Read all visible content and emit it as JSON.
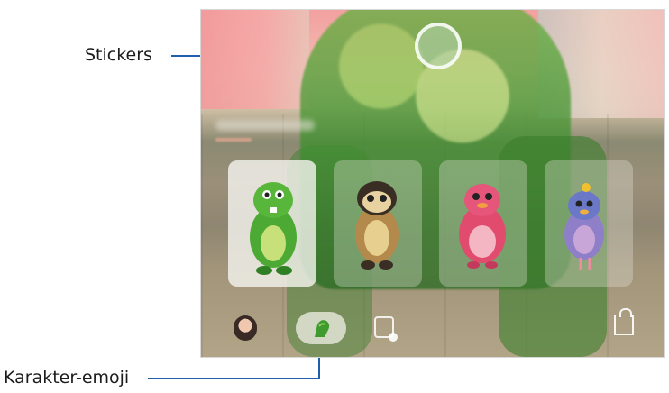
{
  "annotations": {
    "stickers_label": "Stickers",
    "emoji_label": "Karakter-emoji"
  },
  "colors": {
    "callout_line": "#1f5fae",
    "dino_green": "#3d8d2f"
  },
  "screen": {
    "characters": [
      {
        "name": "green-dino",
        "selected": true
      },
      {
        "name": "sloth"
      },
      {
        "name": "pink-bird"
      },
      {
        "name": "blue-bird"
      }
    ],
    "bottom_bar": {
      "icons": [
        "avatar-icon",
        "character-emoji-icon",
        "sticker-icon",
        "store-icon"
      ]
    }
  }
}
